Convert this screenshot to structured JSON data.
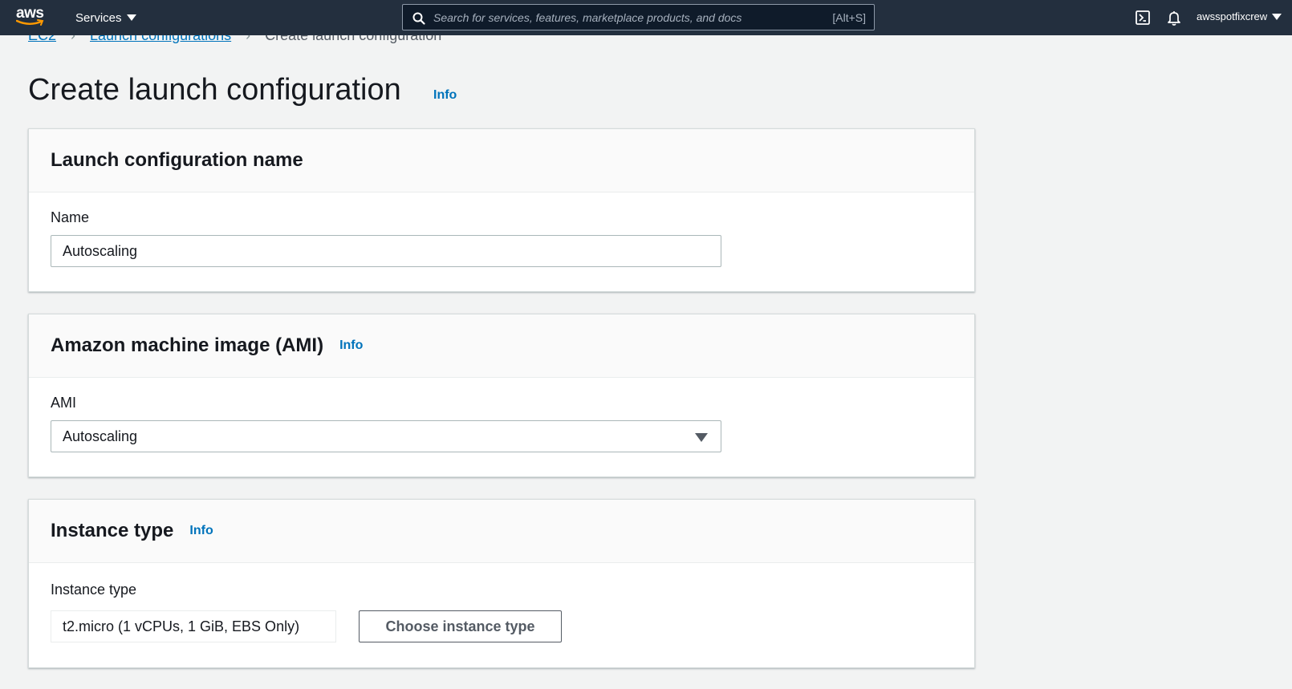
{
  "topnav": {
    "logo_text": "aws",
    "services_label": "Services",
    "search_placeholder": "Search for services, features, marketplace products, and docs",
    "search_shortcut": "[Alt+S]",
    "account_name": "awsspotfixcrew",
    "icons": [
      "cloudshell-icon",
      "bell-icon"
    ]
  },
  "breadcrumb": {
    "items": [
      "EC2",
      "Launch configurations",
      "Create launch configuration"
    ]
  },
  "page": {
    "title": "Create launch configuration",
    "info": "Info"
  },
  "sections": {
    "name": {
      "heading": "Launch configuration name",
      "field_label": "Name",
      "field_value": "Autoscaling"
    },
    "ami": {
      "heading": "Amazon machine image (AMI)",
      "info": "Info",
      "field_label": "AMI",
      "selected_value": "Autoscaling"
    },
    "instance_type": {
      "heading": "Instance type",
      "info": "Info",
      "field_label": "Instance type",
      "field_value": "t2.micro (1 vCPUs, 1 GiB, EBS Only)",
      "choose_button": "Choose instance type"
    }
  },
  "colors": {
    "nav_bg": "#232f3e",
    "page_bg": "#f2f3f3",
    "link": "#0073bb"
  }
}
